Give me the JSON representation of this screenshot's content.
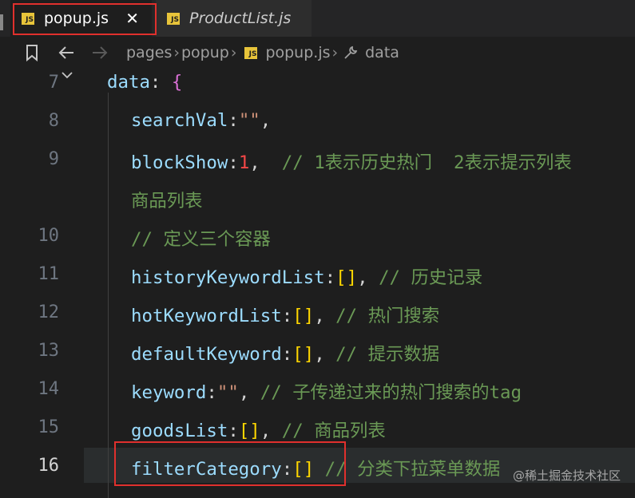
{
  "tabs": [
    {
      "label": "popup.js",
      "badge": "JS",
      "active": true,
      "close": "✕"
    },
    {
      "label": "ProductList.js",
      "badge": "JS",
      "active": false
    }
  ],
  "breadcrumb": {
    "items": [
      "pages",
      "popup",
      "popup.js",
      "data"
    ],
    "separator": "›"
  },
  "code": {
    "lines": [
      {
        "num": "7"
      },
      {
        "num": "8"
      },
      {
        "num": "9"
      },
      {
        "num": ""
      },
      {
        "num": "10"
      },
      {
        "num": "11"
      },
      {
        "num": "12"
      },
      {
        "num": "13"
      },
      {
        "num": "14"
      },
      {
        "num": "15"
      },
      {
        "num": "16",
        "current": true
      }
    ],
    "text": {
      "l7_key": "data",
      "l8_key": "searchVal",
      "l8_val": "\"\"",
      "l9_key": "blockShow",
      "l9_val": "1",
      "l9_comment": "// 1表示历史热门  2表示提示列表",
      "l9b_comment": "商品列表",
      "l10_comment": "// 定义三个容器",
      "l11_key": "historyKeywordList",
      "l11_comment": "// 历史记录",
      "l12_key": "hotKeywordList",
      "l12_comment": "// 热门搜索",
      "l13_key": "defaultKeyword",
      "l13_comment": "// 提示数据",
      "l14_key": "keyword",
      "l14_val": "\"\"",
      "l14_comment": "// 子传递过来的热门搜索的tag",
      "l15_key": "goodsList",
      "l15_comment": "// 商品列表",
      "l16_key": "filterCategory",
      "l16_comment": "// 分类下拉菜单数据"
    }
  },
  "watermark": "@稀土掘金技术社区",
  "colors": {
    "highlight_box": "#e0302d",
    "comment": "#6a9955",
    "property": "#9cdcfe"
  }
}
